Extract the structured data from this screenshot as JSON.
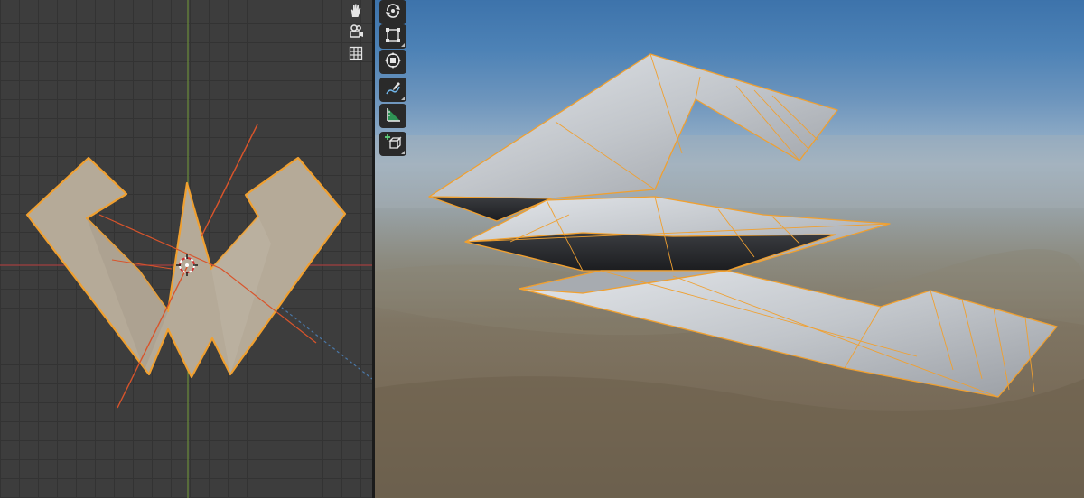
{
  "left_viewport": {
    "navigation_gizmos": [
      {
        "name": "pan-hand-icon"
      },
      {
        "name": "camera-view-icon"
      },
      {
        "name": "orthographic-grid-icon"
      }
    ],
    "colors": {
      "grid_background": "#3d3d3d",
      "grid_line": "#333333",
      "x_axis": "#a33f3f",
      "y_axis": "#6b8c3a",
      "selection_outline": "#f0a030",
      "mesh_fill": "#b5aa98",
      "light_line": "#d9542b"
    }
  },
  "right_viewport": {
    "toolbar": [
      {
        "name": "rotate-tool-icon",
        "active": false
      },
      {
        "name": "scale-cage-tool-icon",
        "active": false
      },
      {
        "name": "transform-tool-icon",
        "active": false
      },
      {
        "name": "annotate-tool-icon",
        "active": false
      },
      {
        "name": "measure-tool-icon",
        "active": false
      },
      {
        "name": "add-cube-tool-icon",
        "active": false
      }
    ],
    "colors": {
      "sky_top": "#3d73ab",
      "horizon": "#a1b4c4",
      "ground": "#786b58",
      "aircraft_skin": "#c9ccd0",
      "wireframe": "#f0a030"
    }
  }
}
